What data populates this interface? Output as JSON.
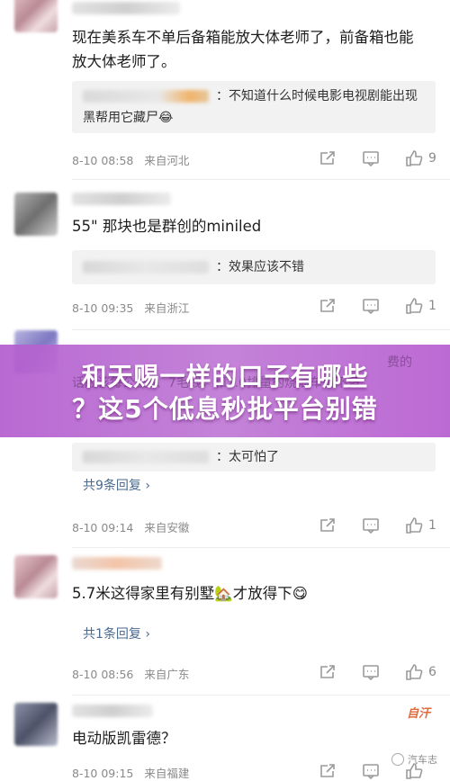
{
  "comments": [
    {
      "text": "现在美系车不单后备箱能放大体老师了，前备箱也能放大体老师了。",
      "quote": "：不知道什么时候电影电视剧能出现黑帮用它藏尸😂",
      "time": "8-10 08:58",
      "location": "来自河北",
      "likes": "9"
    },
    {
      "text": "55\" 那块也是群创的miniled",
      "quote": "：效果应该不错",
      "time": "8-10 09:35",
      "location": "来自浙江",
      "likes": "1"
    },
    {
      "text_fragment_1": "费的",
      "text_fragment_2": "话应该每公里6、7毛钱，和2.0排量的烧油车差不多",
      "quote": "：太可怕了",
      "replies": "共9条回复 ›",
      "time": "8-10 09:14",
      "location": "来自安徽",
      "likes": "1"
    },
    {
      "text": "5.7米这得家里有别墅🏡才放得下😋",
      "replies": "共1条回复 ›",
      "time": "8-10 08:56",
      "location": "来自广东",
      "likes": "6"
    },
    {
      "text": "电动版凯雷德？",
      "time": "8-10 09:15",
      "location": "来自福建",
      "likes": ""
    }
  ],
  "banner": {
    "line1": "和天赐一样的口子有哪些",
    "line2": "？这5个低息秒批平台别错"
  },
  "tag": "自汗",
  "watermark": "汽车志",
  "colors": {
    "banner": "#b85fd0",
    "link": "#4a6a8f",
    "meta": "#8a8a8a"
  }
}
